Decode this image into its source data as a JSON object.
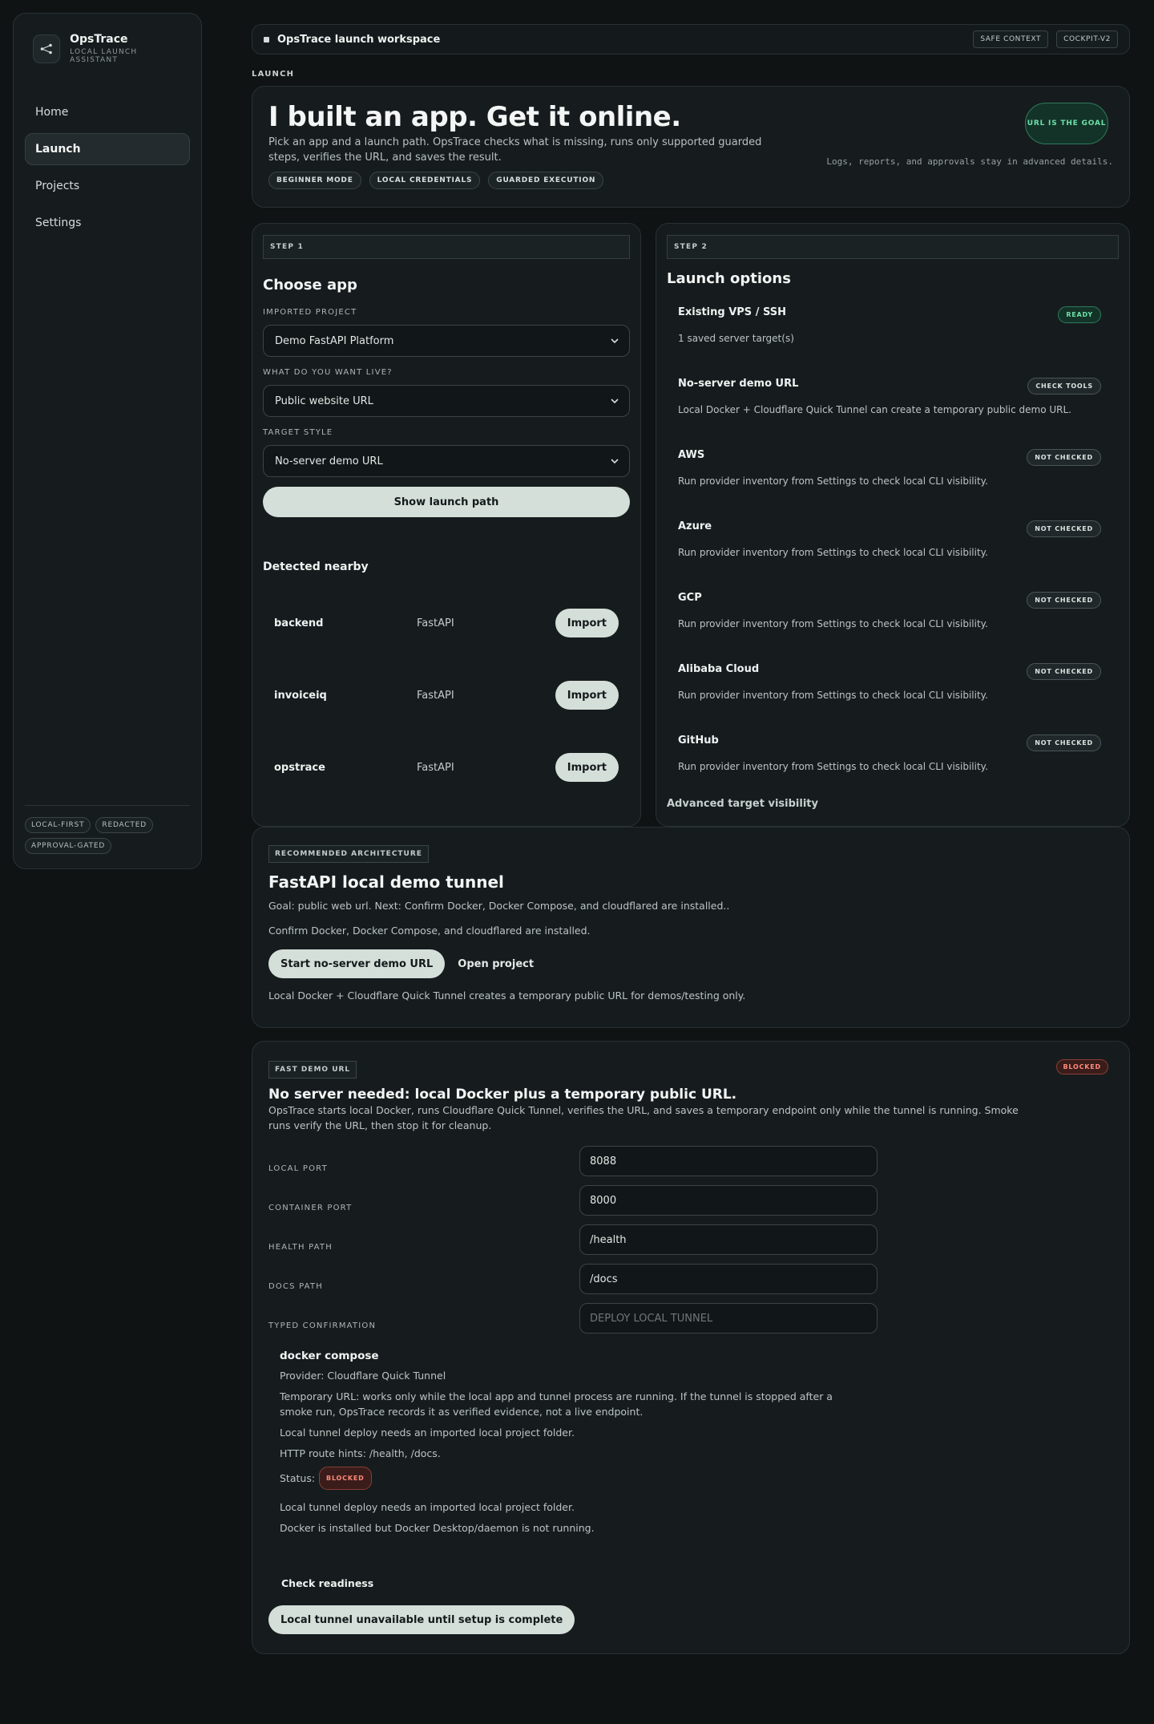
{
  "sidebar": {
    "brand_name": "OpsTrace",
    "brand_sub": "LOCAL LAUNCH ASSISTANT",
    "nav": [
      "Home",
      "Launch",
      "Projects",
      "Settings"
    ],
    "footer_tags": [
      "LOCAL-FIRST",
      "REDACTED",
      "APPROVAL-GATED"
    ]
  },
  "topbar": {
    "title": "OpsTrace launch workspace",
    "chips": [
      "SAFE CONTEXT",
      "COCKPIT-V2"
    ]
  },
  "section_label": "LAUNCH",
  "hero": {
    "title": "I built an app. Get it online.",
    "desc": "Pick an app and a launch path. OpsTrace checks what is missing, runs only supported guarded steps, verifies the URL, and saves the result.",
    "pills": [
      "BEGINNER MODE",
      "LOCAL CREDENTIALS",
      "GUARDED EXECUTION"
    ],
    "goal": "URL IS THE GOAL",
    "note": "Logs, reports, and approvals stay in advanced details."
  },
  "step1": {
    "label": "STEP 1",
    "title": "Choose app",
    "fields": [
      {
        "label": "IMPORTED PROJECT",
        "value": "Demo FastAPI Platform"
      },
      {
        "label": "WHAT DO YOU WANT LIVE?",
        "value": "Public website URL"
      },
      {
        "label": "TARGET STYLE",
        "value": "No-server demo URL"
      }
    ],
    "show_btn": "Show launch path",
    "nearby_title": "Detected nearby",
    "nearby": [
      {
        "name": "backend",
        "kind": "FastAPI",
        "action": "Import"
      },
      {
        "name": "invoiceiq",
        "kind": "FastAPI",
        "action": "Import"
      },
      {
        "name": "opstrace",
        "kind": "FastAPI",
        "action": "Import"
      }
    ]
  },
  "step2": {
    "label": "STEP 2",
    "title": "Launch options",
    "options": [
      {
        "name": "Existing VPS / SSH",
        "badge": "READY",
        "desc": "1 saved server target(s)"
      },
      {
        "name": "No-server demo URL",
        "badge": "CHECK TOOLS",
        "desc": "Local Docker + Cloudflare Quick Tunnel can create a temporary public demo URL."
      },
      {
        "name": "AWS",
        "badge": "NOT CHECKED",
        "desc": "Run provider inventory from Settings to check local CLI visibility."
      },
      {
        "name": "Azure",
        "badge": "NOT CHECKED",
        "desc": "Run provider inventory from Settings to check local CLI visibility."
      },
      {
        "name": "GCP",
        "badge": "NOT CHECKED",
        "desc": "Run provider inventory from Settings to check local CLI visibility."
      },
      {
        "name": "Alibaba Cloud",
        "badge": "NOT CHECKED",
        "desc": "Run provider inventory from Settings to check local CLI visibility."
      },
      {
        "name": "GitHub",
        "badge": "NOT CHECKED",
        "desc": "Run provider inventory from Settings to check local CLI visibility."
      }
    ],
    "advanced": "Advanced target visibility"
  },
  "arch": {
    "label": "RECOMMENDED ARCHITECTURE",
    "title": "FastAPI local demo tunnel",
    "goal": "Goal: public web url. Next: Confirm Docker, Docker Compose, and cloudflared are installed..",
    "next": "Confirm Docker, Docker Compose, and cloudflared are installed.",
    "primary": "Start no-server demo URL",
    "secondary": "Open project",
    "note": "Local Docker + Cloudflare Quick Tunnel creates a temporary public URL for demos/testing only."
  },
  "fast": {
    "label": "FAST DEMO URL",
    "status": "BLOCKED",
    "title": "No server needed: local Docker plus a temporary public URL.",
    "desc": "OpsTrace starts local Docker, runs Cloudflare Quick Tunnel, verifies the URL, and saves a temporary endpoint only while the tunnel is running. Smoke runs verify the URL, then stop it for cleanup.",
    "fields": [
      {
        "label": "LOCAL PORT",
        "value": "8088",
        "placeholder": ""
      },
      {
        "label": "CONTAINER PORT",
        "value": "8000",
        "placeholder": ""
      },
      {
        "label": "HEALTH PATH",
        "value": "/health",
        "placeholder": ""
      },
      {
        "label": "DOCS PATH",
        "value": "/docs",
        "placeholder": ""
      },
      {
        "label": "TYPED CONFIRMATION",
        "value": "",
        "placeholder": "DEPLOY LOCAL TUNNEL"
      }
    ],
    "detail_title": "docker compose",
    "provider": "Provider: Cloudflare Quick Tunnel",
    "temp_url": "Temporary URL: works only while the local app and tunnel process are running. If the tunnel is stopped after a smoke run, OpsTrace records it as verified evidence, not a live endpoint.",
    "needs_folder": "Local tunnel deploy needs an imported local project folder.",
    "route_hints": "HTTP route hints: /health, /docs.",
    "status_label": "Status:",
    "status_value": "BLOCKED",
    "issue1": "Local tunnel deploy needs an imported local project folder.",
    "issue2": "Docker is installed but Docker Desktop/daemon is not running.",
    "check_btn": "Check readiness",
    "unavailable_btn": "Local tunnel unavailable until setup is complete"
  }
}
